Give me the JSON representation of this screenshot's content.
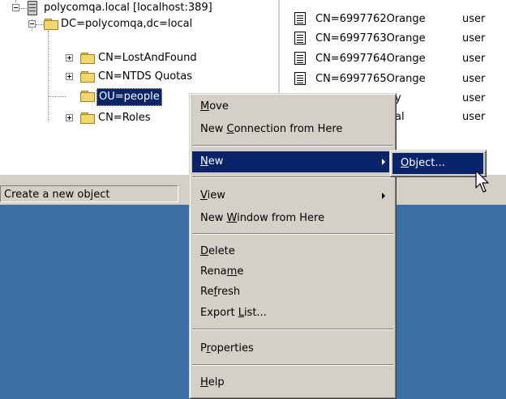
{
  "tree": {
    "root": {
      "label": "polycomqa.local [localhost:389]"
    },
    "domain": {
      "label": "DC=polycomqa,dc=local"
    },
    "children": [
      {
        "label": "CN=LostAndFound"
      },
      {
        "label": "CN=NTDS Quotas"
      },
      {
        "label": "OU=people"
      },
      {
        "label": "CN=Roles"
      }
    ]
  },
  "list": {
    "rows": [
      {
        "name": "CN=6997762Orange",
        "type": "user"
      },
      {
        "name": "CN=6997763Orange",
        "type": "user"
      },
      {
        "name": "CN=6997764Orange",
        "type": "user"
      },
      {
        "name": "CN=6997765Orange",
        "type": "user"
      },
      {
        "name": "y",
        "type": "user"
      },
      {
        "name": "al",
        "type": "user"
      }
    ]
  },
  "status_bar": {
    "text": "Create a new object"
  },
  "context_menu": {
    "items": [
      {
        "pre": "",
        "key": "M",
        "post": "ove"
      },
      {
        "pre": "New ",
        "key": "C",
        "post": "onnection from Here"
      },
      {
        "pre": "",
        "key": "N",
        "post": "ew"
      },
      {
        "pre": "",
        "key": "V",
        "post": "iew"
      },
      {
        "pre": "New ",
        "key": "W",
        "post": "indow from Here"
      },
      {
        "pre": "",
        "key": "D",
        "post": "elete"
      },
      {
        "pre": "Rena",
        "key": "m",
        "post": "e"
      },
      {
        "pre": "Re",
        "key": "f",
        "post": "resh"
      },
      {
        "pre": "Export ",
        "key": "L",
        "post": "ist..."
      },
      {
        "pre": "P",
        "key": "r",
        "post": "operties"
      },
      {
        "pre": "",
        "key": "H",
        "post": "elp"
      }
    ]
  },
  "submenu": {
    "item": {
      "pre": "",
      "key": "O",
      "post": "bject..."
    }
  },
  "colors": {
    "selection": "#0a246a",
    "menu_face": "#d4d0c8",
    "desktop": "#3a6ea5"
  }
}
